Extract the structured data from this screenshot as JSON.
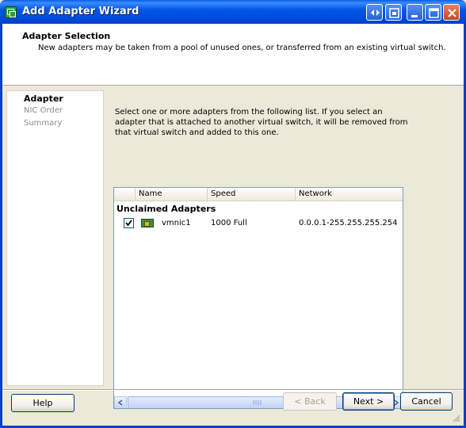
{
  "window": {
    "title": "Add Adapter Wizard"
  },
  "header": {
    "title": "Adapter Selection",
    "subtitle": "New adapters may be taken from a pool of unused ones, or transferred from an existing virtual switch."
  },
  "steps": [
    {
      "label": "Adapter",
      "active": true
    },
    {
      "label": "NIC Order",
      "active": false
    },
    {
      "label": "Summary",
      "active": false
    }
  ],
  "description": "Select one or more adapters from the following list. If you select an adapter that is attached to another virtual switch, it will be removed from that virtual switch and added to this one.",
  "list": {
    "columns": [
      "Name",
      "Speed",
      "Network"
    ],
    "group": "Unclaimed Adapters",
    "rows": [
      {
        "checked": true,
        "icon": "network-adapter-icon",
        "name": "vmnic1",
        "speed": "1000 Full",
        "network": "0.0.0.1-255.255.255.254"
      }
    ]
  },
  "buttons": {
    "help": "Help",
    "back": "< Back",
    "next": "Next >",
    "cancel": "Cancel"
  },
  "colors": {
    "titlebar": "#0058e6",
    "face": "#ece9d8"
  }
}
